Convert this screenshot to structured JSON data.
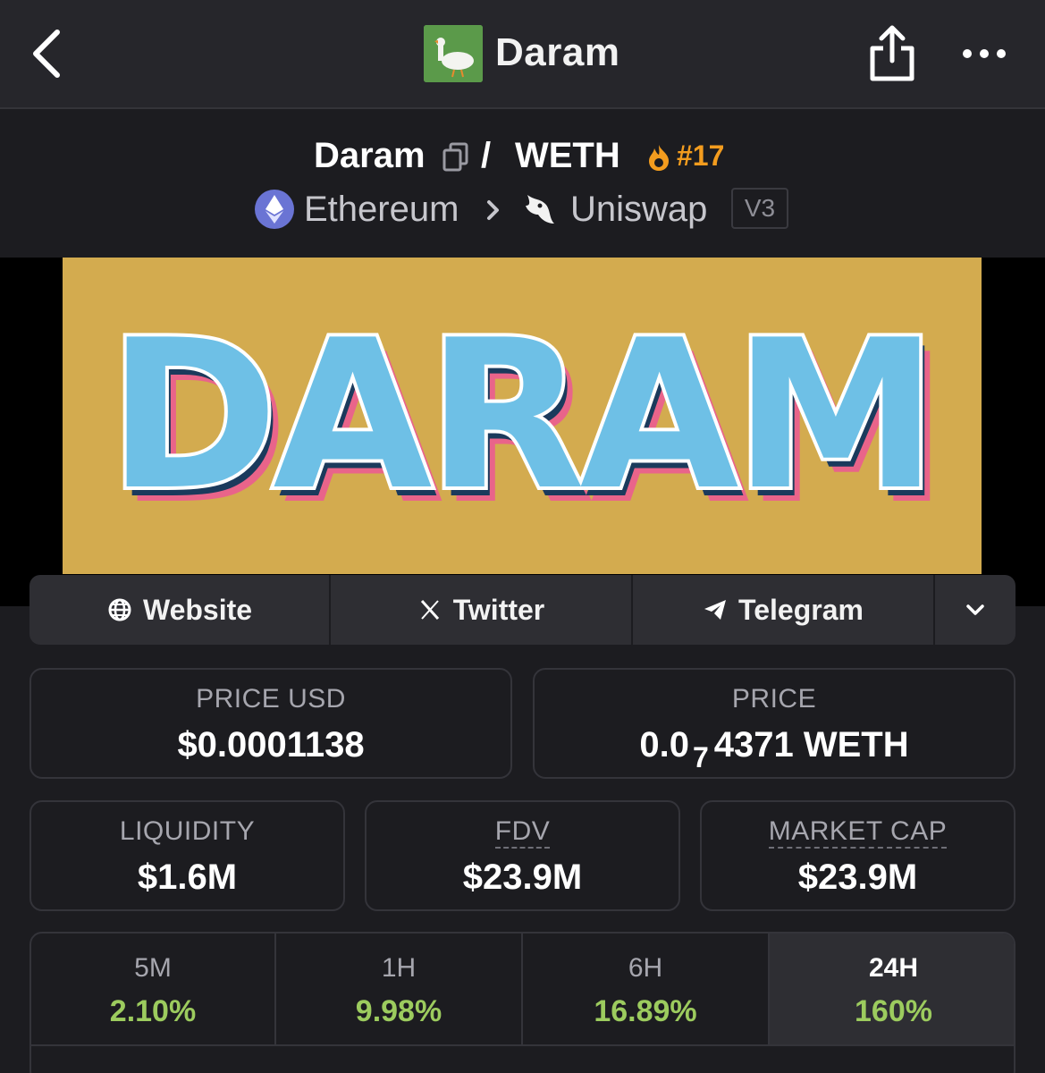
{
  "nav": {
    "title": "Daram",
    "back_icon": "chevron-left-icon",
    "share_icon": "share-icon",
    "more_icon": "more-horizontal-icon"
  },
  "pair": {
    "base": "Daram",
    "separator": "/",
    "quote": "WETH",
    "rank": "#17",
    "chain": "Ethereum",
    "dex": "Uniswap",
    "version": "V3"
  },
  "banner": {
    "text": "DARAM"
  },
  "social": {
    "website": "Website",
    "twitter": "Twitter",
    "telegram": "Telegram"
  },
  "stats": {
    "price_usd": {
      "label": "PRICE USD",
      "value": "$0.0001138"
    },
    "price": {
      "label": "PRICE",
      "value_prefix": "0.0",
      "value_sub": "7",
      "value_suffix": "4371 WETH"
    },
    "liquidity": {
      "label": "LIQUIDITY",
      "value": "$1.6M"
    },
    "fdv": {
      "label": "FDV",
      "value": "$23.9M"
    },
    "market_cap": {
      "label": "MARKET CAP",
      "value": "$23.9M"
    }
  },
  "changes": [
    {
      "label": "5M",
      "value": "2.10%"
    },
    {
      "label": "1H",
      "value": "9.98%"
    },
    {
      "label": "6H",
      "value": "16.89%"
    },
    {
      "label": "24H",
      "value": "160%"
    }
  ],
  "colors": {
    "accent_positive": "#9ccb5e",
    "rank_orange": "#f39c1e",
    "banner_bg": "#d3ab4f",
    "banner_letters": "#6ec0e6"
  }
}
